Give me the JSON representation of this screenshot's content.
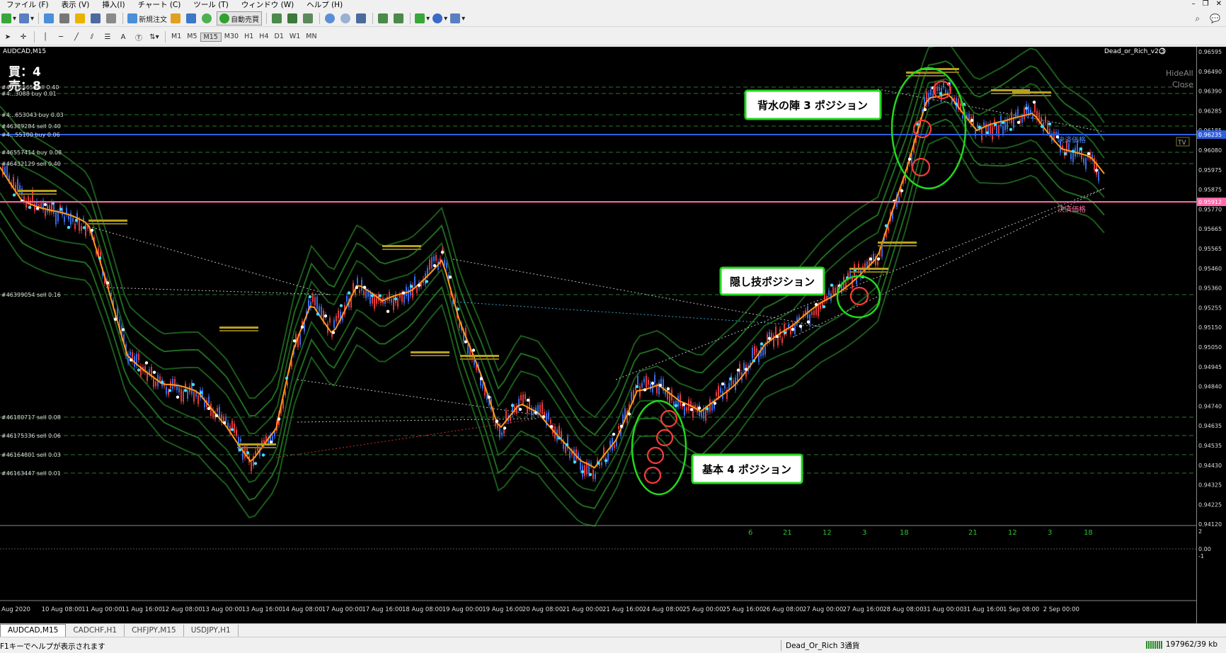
{
  "menu": {
    "items": [
      "ファイル (F)",
      "表示 (V)",
      "挿入(I)",
      "チャート (C)",
      "ツール (T)",
      "ウィンドウ (W)",
      "ヘルプ (H)"
    ]
  },
  "toolbar": {
    "new_order": "新規注文",
    "auto_trade": "自動売買",
    "timeframes": [
      "M1",
      "M5",
      "M15",
      "M30",
      "H1",
      "H4",
      "D1",
      "W1",
      "MN"
    ],
    "text_tool": "A"
  },
  "chart": {
    "symbol_title": "AUDCAD,M15",
    "indicator_name": "Dead_or_Rich_v2.3",
    "buy_count": "買：4",
    "sell_count": "売：8",
    "hide_all": "HideAll",
    "close_label": "Close",
    "tv_badge": "TV",
    "settle_price_blue": "決済価格",
    "settle_price_pink": "決済価格",
    "blue_line_price": "0.96235",
    "pink_line_price": "0.95912",
    "callouts": {
      "haisui": "背水の陣 3 ポジション",
      "kakushi": "隠し技ポジション",
      "kihon": "基本 4 ポジション"
    },
    "order_labels": [
      "#46...1565 sell 0.40",
      "#4...3088 buy 0.01",
      "#4...653043 buy 0.03",
      "#46389284 sell 0.40",
      "#4...55100 buy 0.06",
      "#46557414 buy 0.08",
      "#46432129 sell 0.40",
      "#46399054 sell 0.16",
      "#46180717 sell 0.08",
      "#46175336 sell 0.06",
      "#46164801 sell 0.03",
      "#46163447 sell 0.01"
    ],
    "price_ticks": [
      "0.96595",
      "0.96490",
      "0.96390",
      "0.96285",
      "0.96185",
      "0.96080",
      "0.95975",
      "0.95875",
      "0.95770",
      "0.95665",
      "0.95565",
      "0.95460",
      "0.95360",
      "0.95255",
      "0.95150",
      "0.95050",
      "0.94945",
      "0.94840",
      "0.94740",
      "0.94635",
      "0.94535",
      "0.94430",
      "0.94325",
      "0.94225",
      "0.94120"
    ],
    "time_ticks": [
      "Aug 2020",
      "10 Aug 08:00",
      "11 Aug 00:00",
      "11 Aug 16:00",
      "12 Aug 08:00",
      "13 Aug 00:00",
      "13 Aug 16:00",
      "14 Aug 08:00",
      "17 Aug 00:00",
      "17 Aug 16:00",
      "18 Aug 08:00",
      "19 Aug 00:00",
      "19 Aug 16:00",
      "20 Aug 08:00",
      "21 Aug 00:00",
      "21 Aug 16:00",
      "24 Aug 08:00",
      "25 Aug 00:00",
      "25 Aug 16:00",
      "26 Aug 08:00",
      "27 Aug 00:00",
      "27 Aug 16:00",
      "28 Aug 08:00",
      "31 Aug 00:00",
      "31 Aug 16:00",
      "1 Sep 08:00",
      "2 Sep 00:00"
    ],
    "sub_numbers": [
      "6",
      "21",
      "12",
      "3",
      "18",
      "21",
      "12",
      "3",
      "18"
    ],
    "sub_axis": [
      "2",
      "0.00",
      "-1"
    ]
  },
  "colors": {
    "background": "#000000",
    "ma_orange": "#ff9a1a",
    "band_green": "#1f6b1f",
    "blue_line": "#2d5fe0",
    "pink_line": "#ff6aa8",
    "callout_border": "#22d81e",
    "circle_red": "#ff3a3a"
  },
  "tabs": [
    "AUDCAD,M15",
    "CADCHF,H1",
    "CHFJPY,M15",
    "USDJPY,H1"
  ],
  "status": {
    "help": "F1キーでヘルプが表示されます",
    "profile": "Dead_Or_Rich 3通貨",
    "traffic": "197962/39 kb"
  }
}
